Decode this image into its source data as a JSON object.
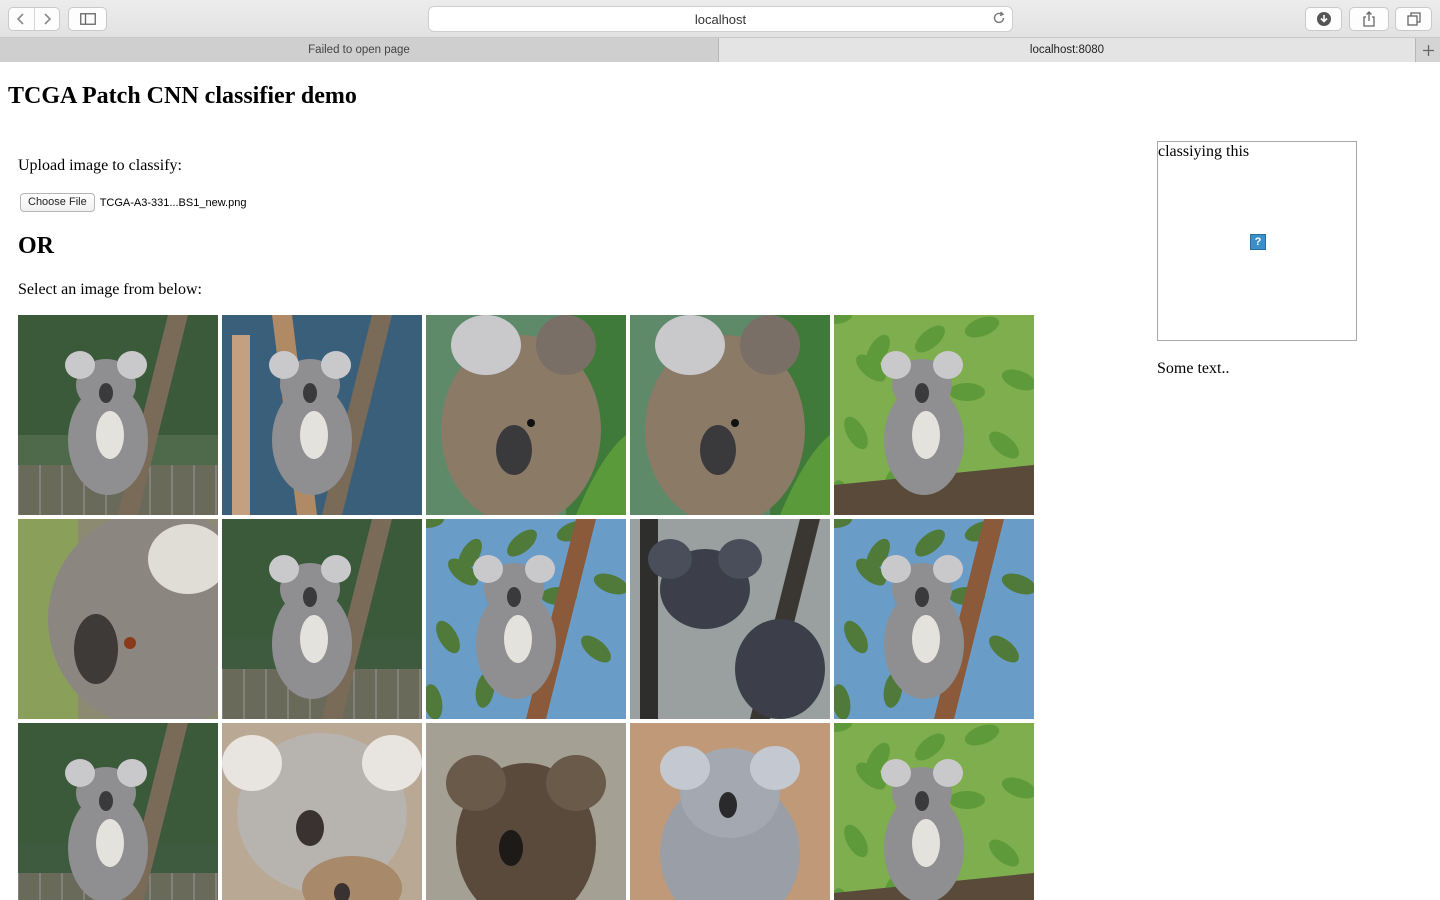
{
  "browser": {
    "address": "localhost",
    "tabs": [
      {
        "label": "Failed to open page",
        "active": false
      },
      {
        "label": "localhost:8080",
        "active": true
      }
    ],
    "icons": [
      "back-icon",
      "forward-icon",
      "sidebar-icon",
      "reload-icon",
      "download-icon",
      "share-icon",
      "tabs-overview-icon",
      "new-tab-icon"
    ]
  },
  "page": {
    "title": "TCGA Patch CNN classifier demo",
    "upload_label": "Upload image to classify:",
    "choose_file_label": "Choose File",
    "file_name": "TCGA-A3-331...BS1_new.png",
    "or_heading": "OR",
    "select_label": "Select an image from below:",
    "preview_caption": "classiying this",
    "some_text": "Some text.."
  },
  "gallery": {
    "subject": "koala photo",
    "items": [
      {
        "variant": "climbing-fence",
        "bg": "#4f6a4a"
      },
      {
        "variant": "tree-fork-blue",
        "bg": "#3a5f7a"
      },
      {
        "variant": "closeup-green",
        "bg": "#5e8a6a"
      },
      {
        "variant": "closeup-green",
        "bg": "#5e8a6a"
      },
      {
        "variant": "branch-leaves",
        "bg": "#7fae4f"
      },
      {
        "variant": "face-closeup",
        "bg": "#8c8a70"
      },
      {
        "variant": "climbing-fence",
        "bg": "#3e5a3f"
      },
      {
        "variant": "eucalyptus-sky",
        "bg": "#6a9cc8"
      },
      {
        "variant": "dark-trunks",
        "bg": "#9aa0a0"
      },
      {
        "variant": "eucalyptus-sky",
        "bg": "#6a9cc8"
      },
      {
        "variant": "climbing-fence",
        "bg": "#3e5a3f"
      },
      {
        "variant": "mother-joey",
        "bg": "#b9a893"
      },
      {
        "variant": "brown-koala",
        "bg": "#a4a094"
      },
      {
        "variant": "sitting-brown",
        "bg": "#c09a78"
      },
      {
        "variant": "branch-leaves",
        "bg": "#7fae4f"
      }
    ]
  }
}
